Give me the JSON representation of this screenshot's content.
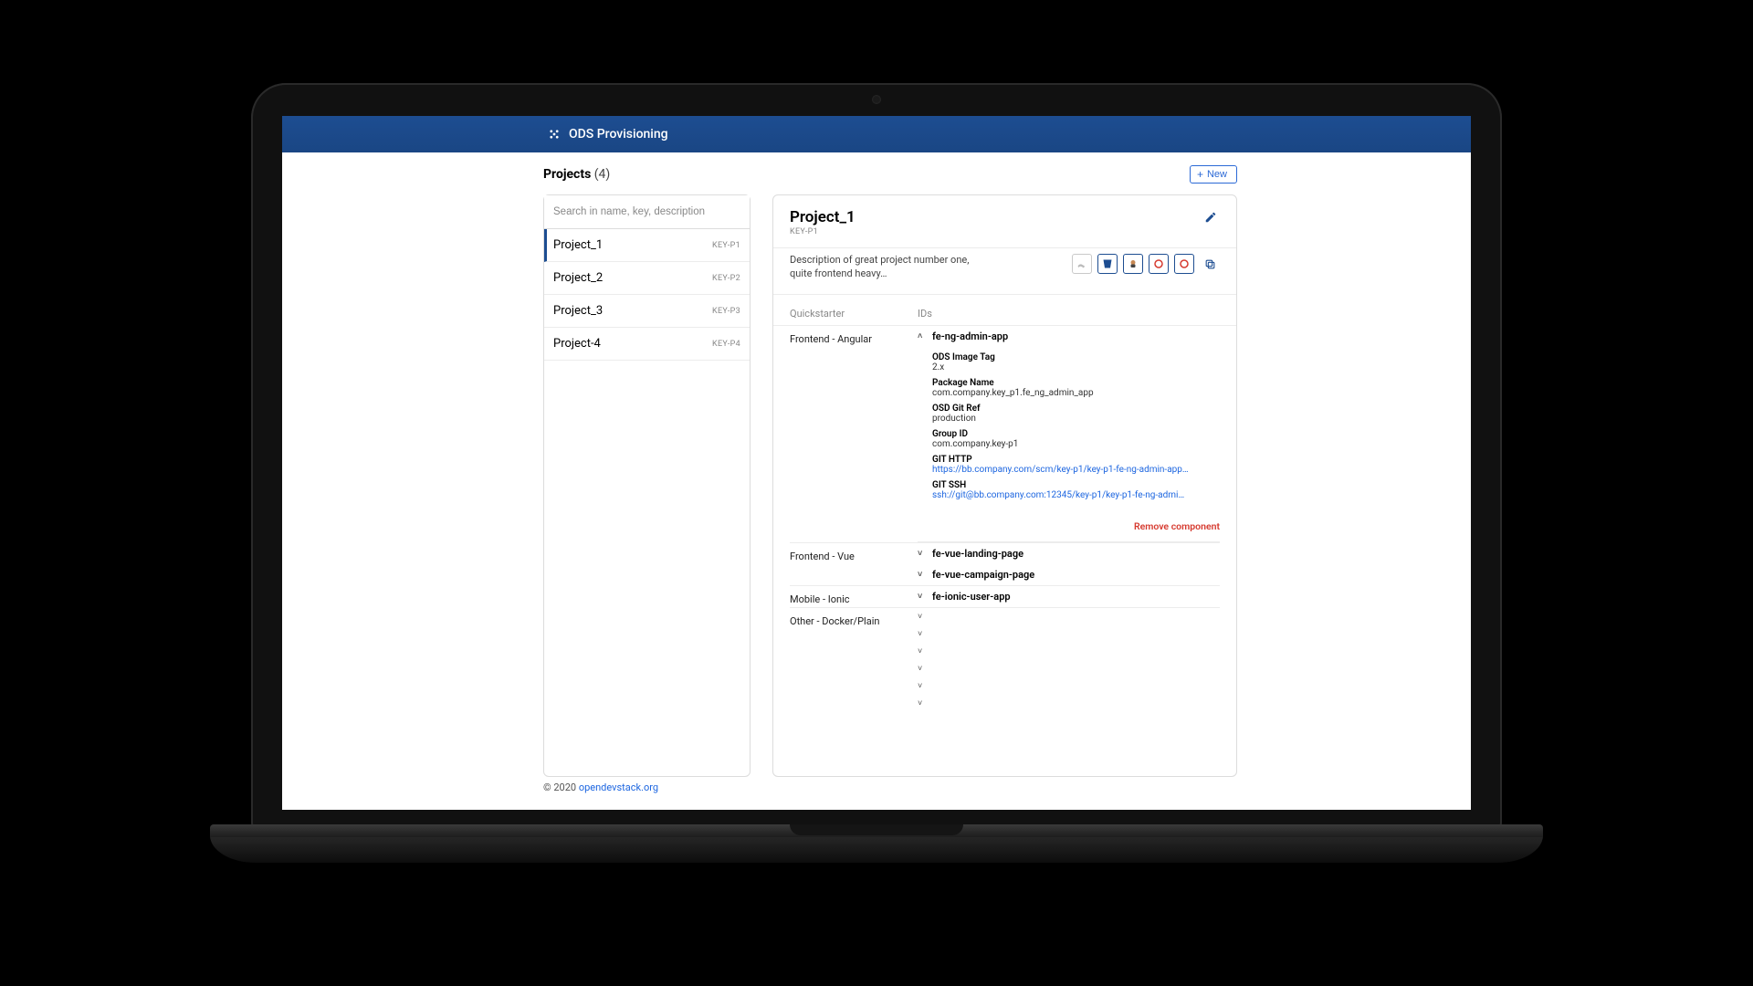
{
  "header": {
    "title": "ODS Provisioning"
  },
  "projects_panel": {
    "heading": "Projects",
    "count": "(4)",
    "new_btn": "New",
    "search_placeholder": "Search in name, key, description",
    "items": [
      {
        "name": "Project_1",
        "key": "KEY-P1",
        "selected": true
      },
      {
        "name": "Project_2",
        "key": "KEY-P2",
        "selected": false
      },
      {
        "name": "Project_3",
        "key": "KEY-P3",
        "selected": false
      },
      {
        "name": "Project-4",
        "key": "KEY-P4",
        "selected": false
      }
    ]
  },
  "detail": {
    "title": "Project_1",
    "key": "KEY-P1",
    "description": "Description of great project number one, quite frontend heavy…",
    "columns": {
      "quickstarter": "Quickstarter",
      "ids": "IDs"
    },
    "links": {
      "confluence": "confluence",
      "bitbucket": "bitbucket",
      "jenkins": "jenkins",
      "openshift_dev": "openshift-dev",
      "openshift_test": "openshift-test",
      "copy": "copy"
    },
    "quickstarters": [
      {
        "name": "Frontend - Angular",
        "ids": [
          {
            "id": "fe-ng-admin-app",
            "expanded": true,
            "fields": [
              {
                "label": "ODS Image Tag",
                "value": "2.x"
              },
              {
                "label": "Package Name",
                "value": "com.company.key_p1.fe_ng_admin_app"
              },
              {
                "label": "OSD Git Ref",
                "value": "production"
              },
              {
                "label": "Group ID",
                "value": "com.company.key-p1"
              },
              {
                "label": "GIT HTTP",
                "value": "https://bb.company.com/scm/key-p1/key-p1-fe-ng-admin-app…",
                "link": true
              },
              {
                "label": "GIT SSH",
                "value": "ssh://git@bb.company.com:12345/key-p1/key-p1-fe-ng-admi…",
                "link": true
              }
            ],
            "remove_label": "Remove component"
          }
        ]
      },
      {
        "name": "Frontend - Vue",
        "ids": [
          {
            "id": "fe-vue-landing-page",
            "expanded": false
          },
          {
            "id": "fe-vue-campaign-page",
            "expanded": false
          }
        ]
      },
      {
        "name": "Mobile - Ionic",
        "ids": [
          {
            "id": "fe-ionic-user-app",
            "expanded": false
          }
        ]
      },
      {
        "name": "Other - Docker/Plain",
        "collapsed_count": 6
      }
    ]
  },
  "footer": {
    "copyright": "© 2020 ",
    "link_text": "opendevstack.org"
  }
}
